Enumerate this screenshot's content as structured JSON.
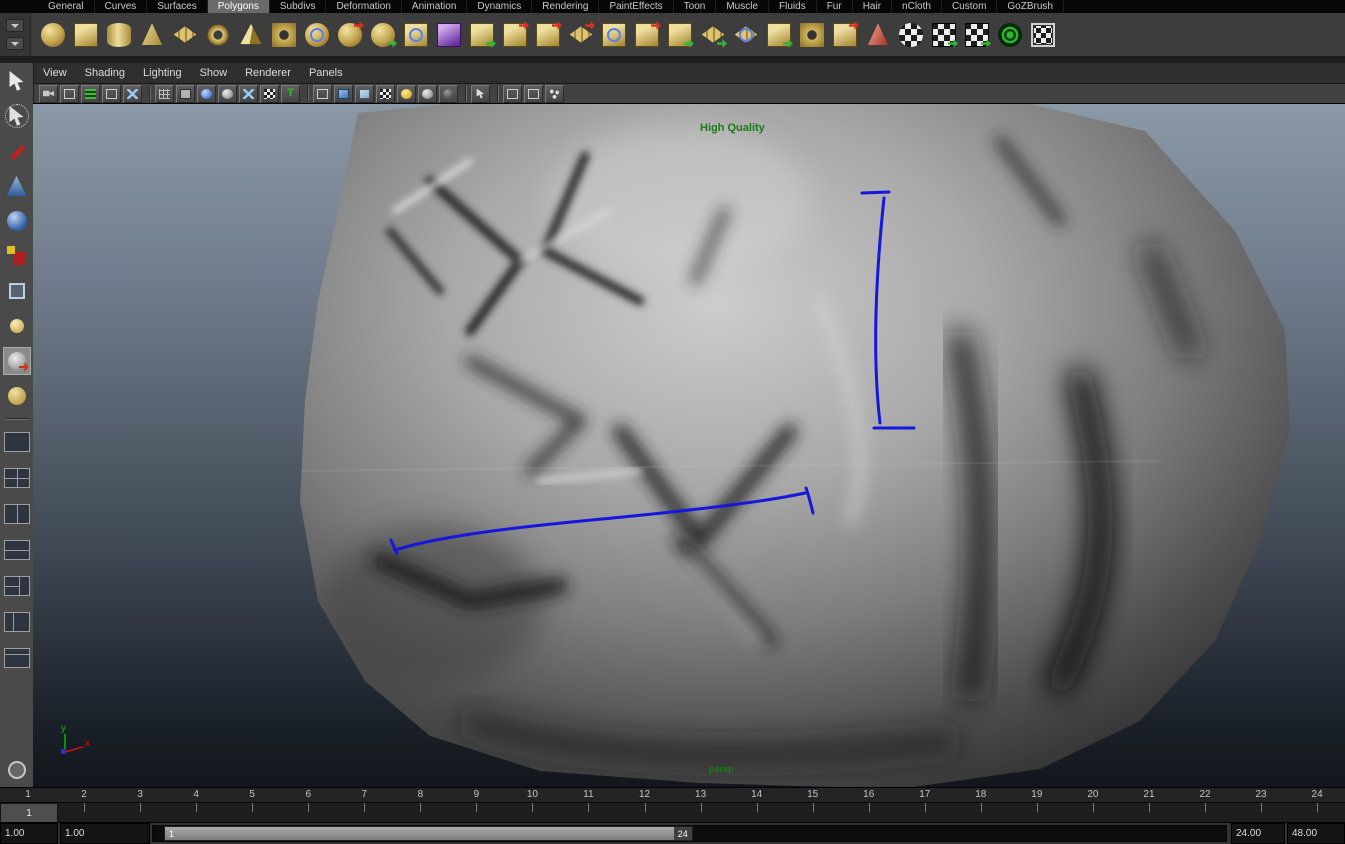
{
  "menubar": {
    "tabs": [
      "General",
      "Curves",
      "Surfaces",
      "Polygons",
      "Subdivs",
      "Deformation",
      "Animation",
      "Dynamics",
      "Rendering",
      "PaintEffects",
      "Toon",
      "Muscle",
      "Fluids",
      "Fur",
      "Hair",
      "nCloth",
      "Custom",
      "GoZBrush"
    ],
    "active_tab": "Polygons"
  },
  "shelf": {
    "icons": [
      "poly-sphere",
      "poly-cube",
      "poly-cylinder",
      "poly-cone",
      "poly-plane",
      "poly-torus",
      "poly-prism",
      "poly-pipe",
      "poly-soccer-ball",
      "poly-platonic-solid",
      "sculpt-geometry",
      "mirror-geometry",
      "subdiv-proxy",
      "smooth-mesh",
      "combine",
      "separate",
      "extract",
      "bevel",
      "boolean",
      "reduce",
      "triangulate",
      "quadrangulate",
      "fill-hole",
      "make-hole",
      "cut-faces",
      "sculpt-cone",
      "uv-checker-sphere",
      "uv-auto-mapping",
      "uv-planar-mapping",
      "uv-spherical-mapping",
      "uv-texture-editor"
    ]
  },
  "panel_menu": {
    "items": [
      "View",
      "Shading",
      "Lighting",
      "Show",
      "Renderer",
      "Panels"
    ]
  },
  "panel_toolbar": {
    "safe_title_glyph": "T"
  },
  "viewport": {
    "quality_label": "High Quality",
    "camera_label": "persp",
    "axis_y_label": "y",
    "axis_x_label": "x"
  },
  "timeline": {
    "frames": [
      "1",
      "2",
      "3",
      "4",
      "5",
      "6",
      "7",
      "8",
      "9",
      "10",
      "11",
      "12",
      "13",
      "14",
      "15",
      "16",
      "17",
      "18",
      "19",
      "20",
      "21",
      "22",
      "23",
      "24"
    ],
    "current_frame": "1"
  },
  "range_slider": {
    "anim_start": "1.00",
    "play_start": "1.00",
    "handle_start_label": "1",
    "handle_end_label": "24",
    "play_end": "24.00",
    "anim_end": "48.00"
  },
  "colors": {
    "stroke_blue": "#1616dd",
    "hud_green": "#157d15",
    "shelf_gold": "#c2a24c"
  }
}
